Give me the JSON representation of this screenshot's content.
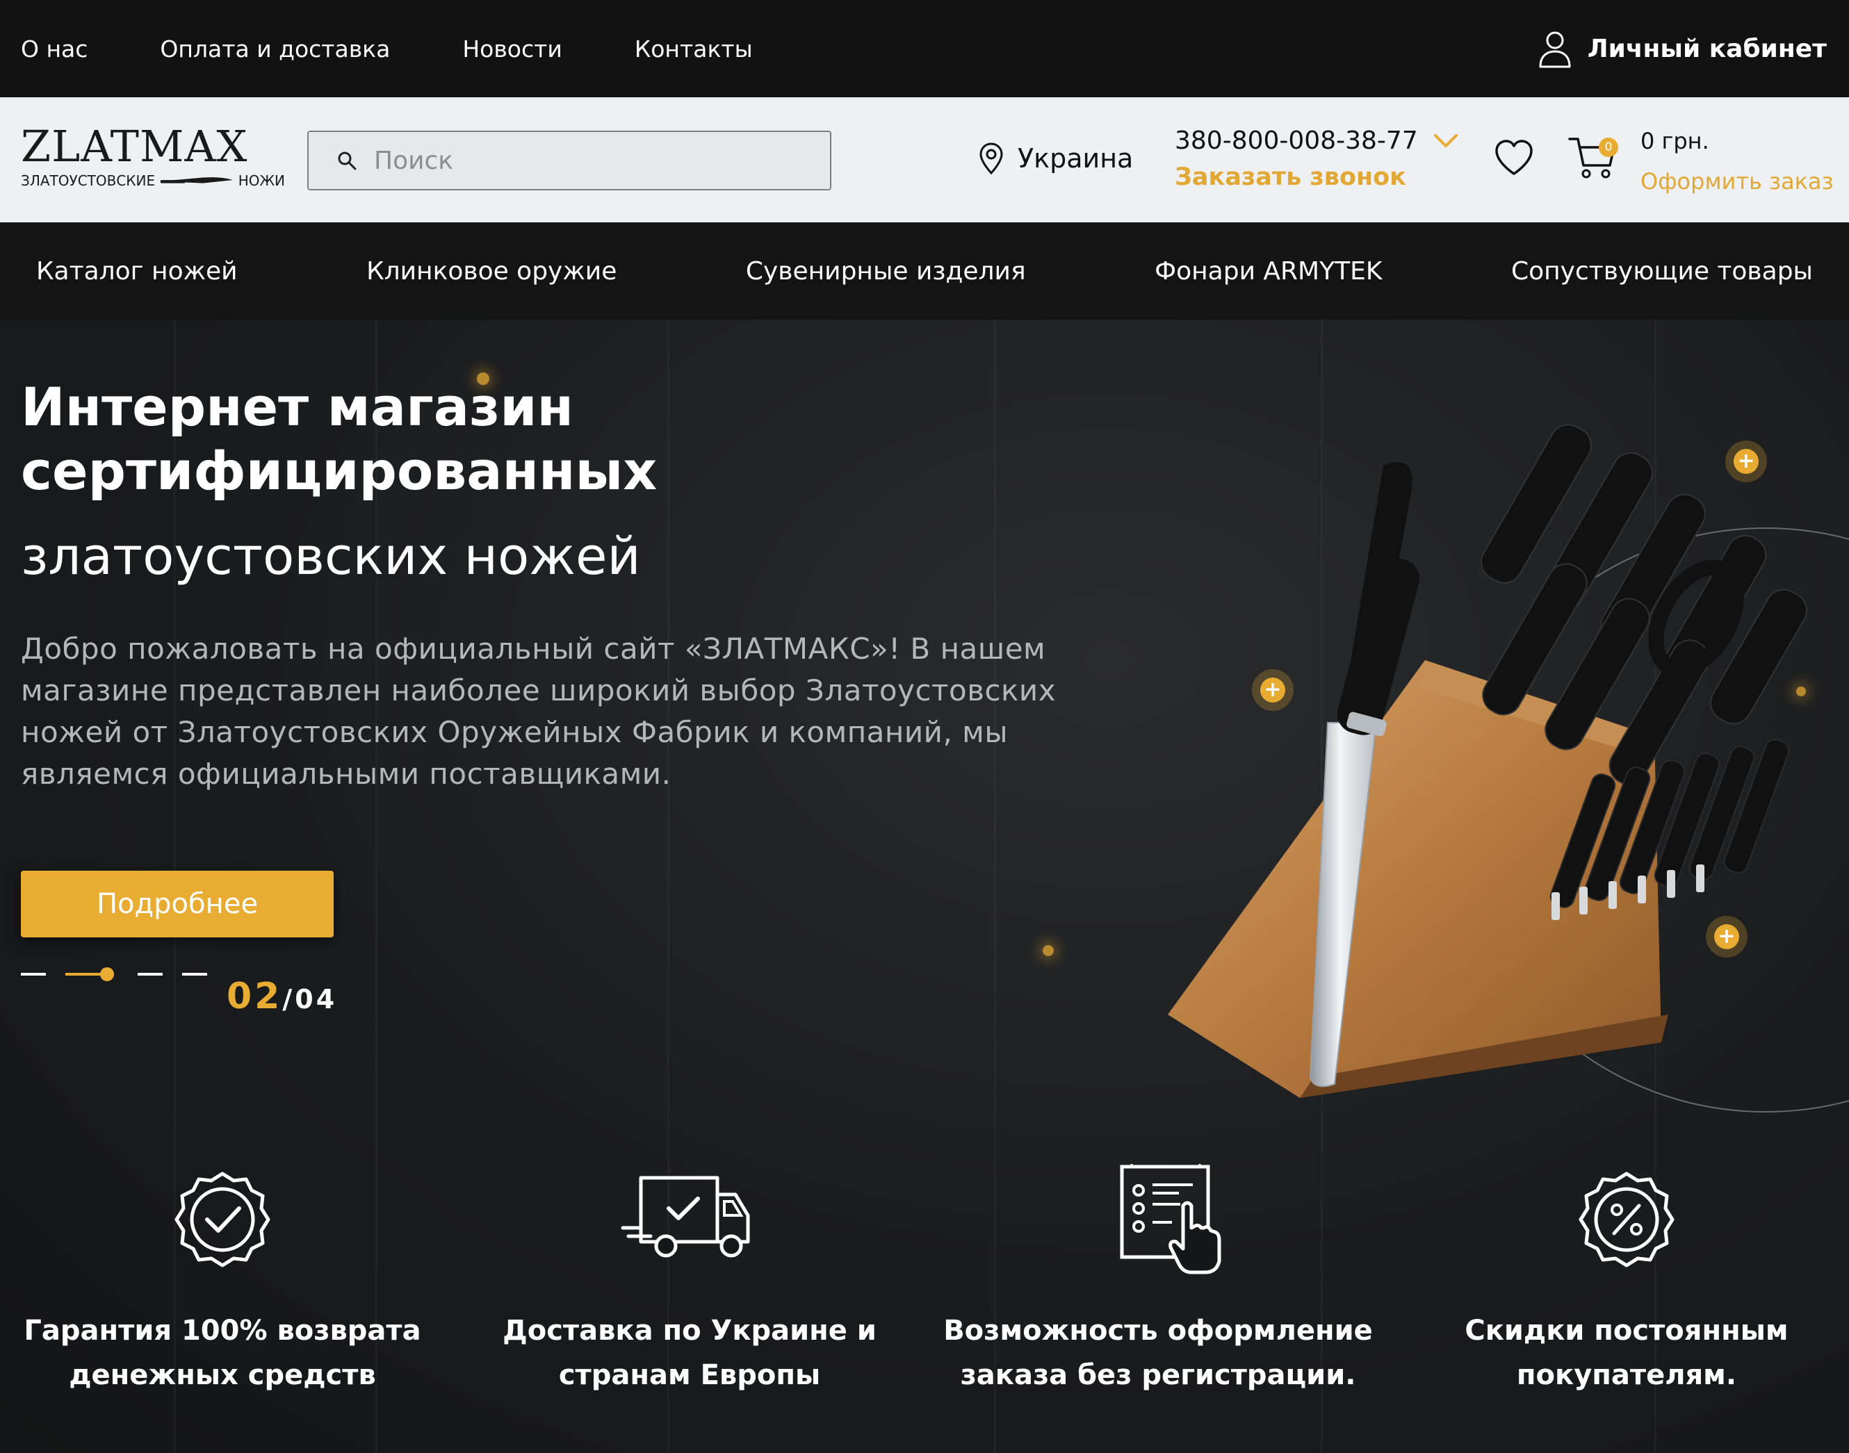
{
  "topbar": {
    "links": [
      "О нас",
      "Оплата и доставка",
      "Новости",
      "Контакты"
    ],
    "account_label": "Личный кабинет",
    "account_icon": "user-icon"
  },
  "header": {
    "logo": {
      "brand": "ZLATMAX",
      "sub_left": "ЗЛАТОУСТОВСКИЕ",
      "sub_right": "НОЖИ"
    },
    "search": {
      "placeholder": "Поиск",
      "icon": "search-icon"
    },
    "region": {
      "label": "Украина",
      "icon": "location-pin-icon"
    },
    "phone": {
      "number": "380-800-008-38-77",
      "callback": "Заказать звонок"
    },
    "favorites_icon": "heart-icon",
    "cart": {
      "icon": "cart-icon",
      "count": "0",
      "total": "0 грн.",
      "checkout": "Оформить заказ"
    }
  },
  "nav": {
    "items": [
      "Каталог ножей",
      "Клинковое оружие",
      "Сувенирные изделия",
      "Фонари ARMYTEK",
      "Сопуствующие товары"
    ]
  },
  "hero": {
    "title_bold": "Интернет магазин сертифицированных",
    "title_light": "златоустовских ножей",
    "description": "Добро пожаловать на официальный сайт «ЗЛАТМАКС»! В нашем магазине представлен наиболее широкий выбор Златоустовских ножей от Златоустовских Оружейных Фабрик и компаний, мы являемся официальными поставщиками.",
    "button": "Подробнее",
    "slide_current": "02",
    "slide_total": "/04",
    "slides_count": 4,
    "active_slide_index": 2,
    "hotspot_label": "+"
  },
  "features": [
    {
      "icon": "badge-check-icon",
      "line1": "Гарантия 100% возврата",
      "line2": "денежных средств"
    },
    {
      "icon": "delivery-truck-icon",
      "line1": "Доставка по Украине и",
      "line2": "странам Европы"
    },
    {
      "icon": "checklist-click-icon",
      "line1": "Возможность оформление",
      "line2": "заказа без регистрации."
    },
    {
      "icon": "discount-badge-icon",
      "line1": "Скидки постоянным",
      "line2": "покупателям."
    }
  ],
  "colors": {
    "accent": "#e9ac33",
    "topbar_bg": "#121212",
    "header_bg": "#eef0f2",
    "hero_bg": "#1b1c1e"
  }
}
